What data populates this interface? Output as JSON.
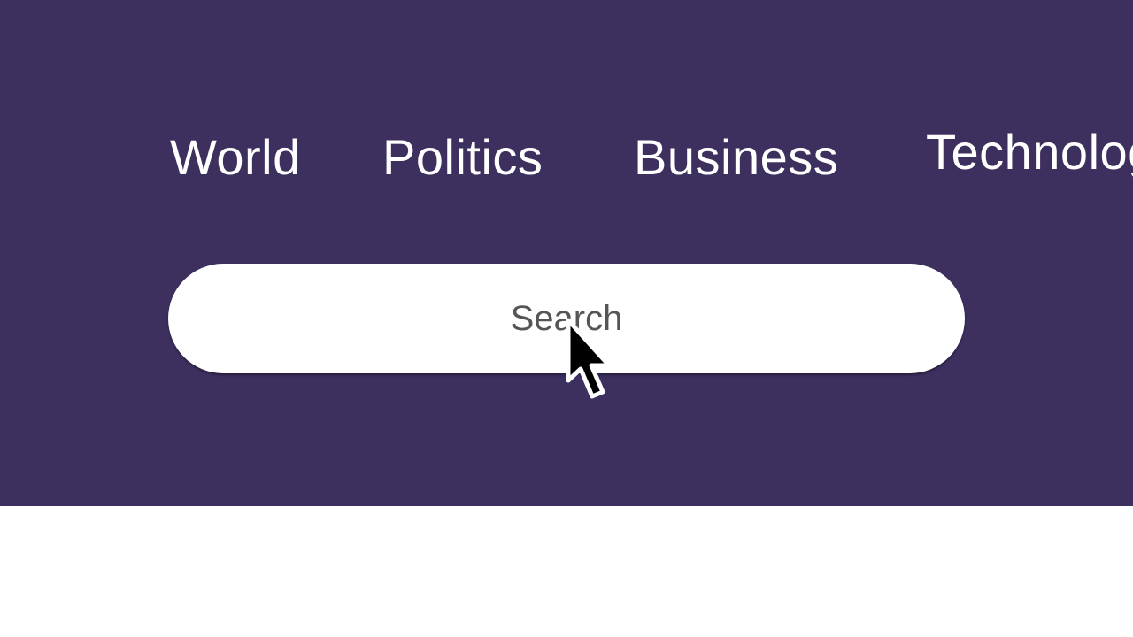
{
  "nav": {
    "items": [
      {
        "label": "World"
      },
      {
        "label": "Politics"
      },
      {
        "label": "Business"
      },
      {
        "label": "Technology"
      }
    ]
  },
  "search": {
    "placeholder": "Search",
    "value": ""
  },
  "colors": {
    "header_bg": "#3d2f5e",
    "nav_text": "#ffffff",
    "search_bg": "#ffffff",
    "search_text": "#555555"
  },
  "icons": {
    "cursor": "mouse-pointer-icon"
  }
}
